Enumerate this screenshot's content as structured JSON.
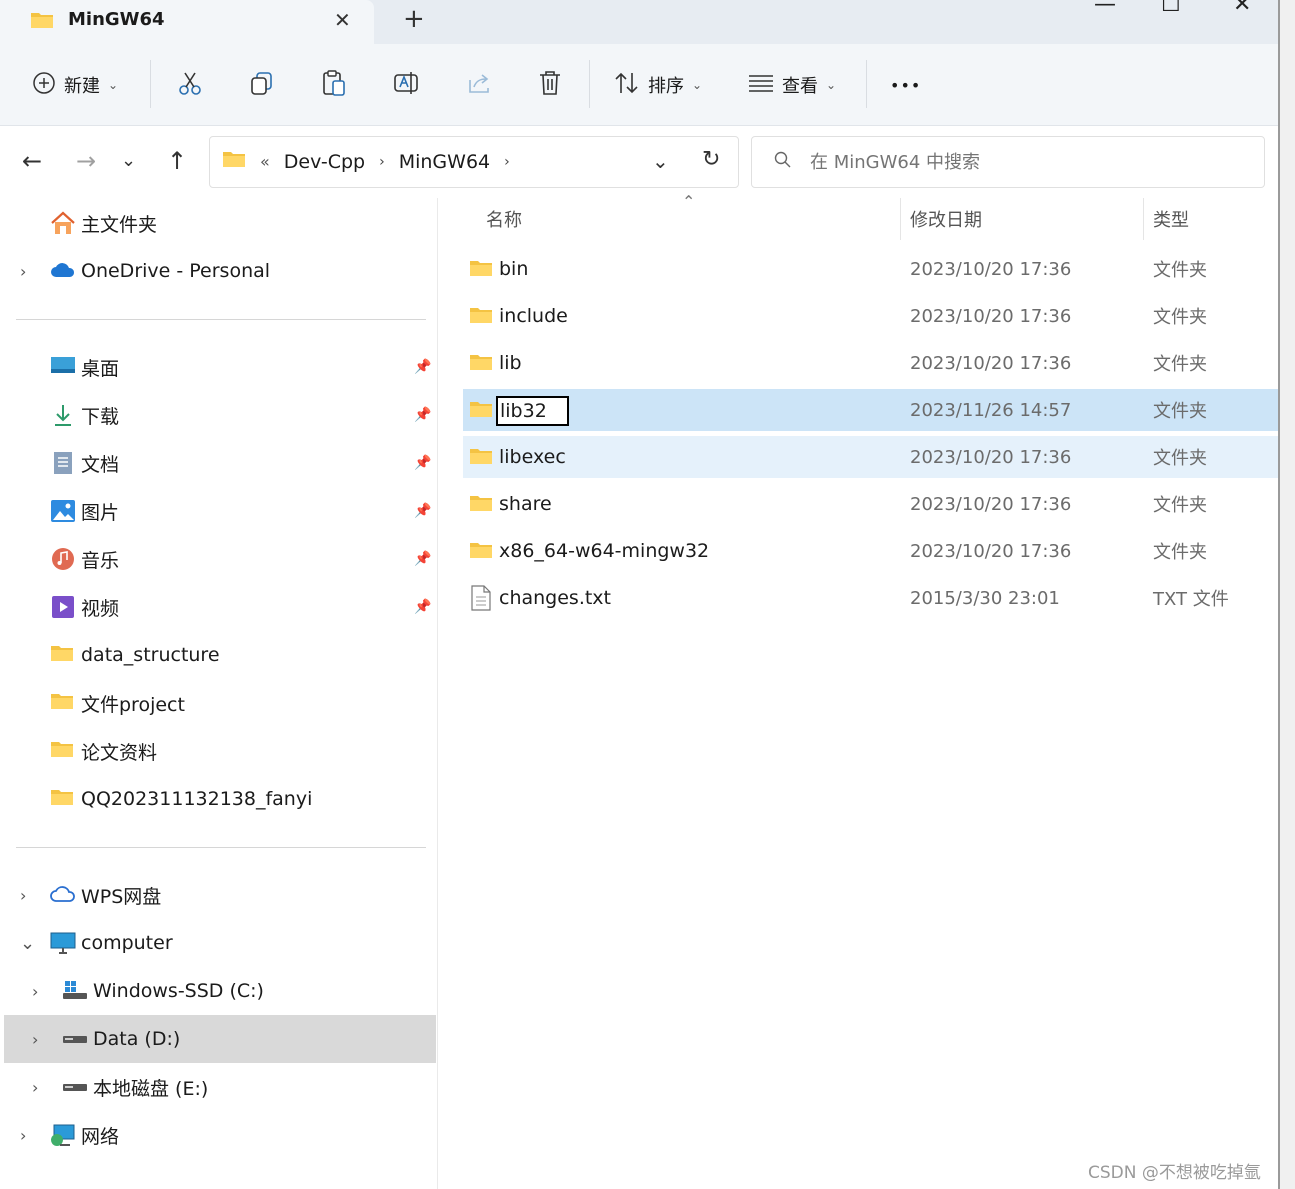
{
  "window": {
    "tab_title": "MinGW64",
    "tab_close": "✕",
    "new_tab": "+",
    "minimize": "—",
    "maximize": "☐",
    "close": "✕"
  },
  "toolbar": {
    "new_label": "新建",
    "sort_label": "排序",
    "view_label": "查看",
    "more_label": "•••"
  },
  "address": {
    "overflow": "«",
    "crumbs": [
      "Dev-Cpp",
      "MinGW64"
    ],
    "search_placeholder": "在 MinGW64 中搜索"
  },
  "nav": {
    "home": "主文件夹",
    "onedrive": "OneDrive - Personal",
    "quick": [
      "桌面",
      "下载",
      "文档",
      "图片",
      "音乐",
      "视频",
      "data_structure",
      "文件project",
      "论文资料",
      "QQ202311132138_fanyi"
    ],
    "wps": "WPS网盘",
    "computer": "computer",
    "drives": [
      "Windows-SSD (C:)",
      "Data (D:)",
      "本地磁盘 (E:)"
    ],
    "network": "网络"
  },
  "columns": {
    "name": "名称",
    "modified": "修改日期",
    "type": "类型"
  },
  "files": [
    {
      "name": "bin",
      "date": "2023/10/20 17:36",
      "type": "文件夹"
    },
    {
      "name": "include",
      "date": "2023/10/20 17:36",
      "type": "文件夹"
    },
    {
      "name": "lib",
      "date": "2023/10/20 17:36",
      "type": "文件夹"
    },
    {
      "name": "lib32",
      "date": "2023/11/26 14:57",
      "type": "文件夹",
      "renaming": true
    },
    {
      "name": "libexec",
      "date": "2023/10/20 17:36",
      "type": "文件夹"
    },
    {
      "name": "share",
      "date": "2023/10/20 17:36",
      "type": "文件夹"
    },
    {
      "name": "x86_64-w64-mingw32",
      "date": "2023/10/20 17:36",
      "type": "文件夹"
    },
    {
      "name": "changes.txt",
      "date": "2015/3/30 23:01",
      "type": "TXT 文件"
    }
  ],
  "watermark": "CSDN @不想被吃掉氩"
}
